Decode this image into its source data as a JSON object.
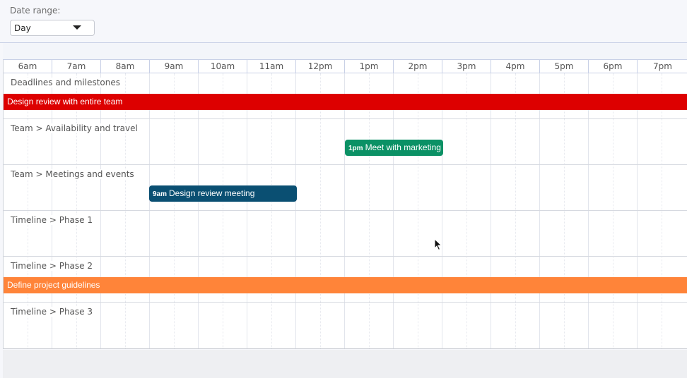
{
  "toolbar": {
    "date_range_label": "Date range:",
    "view_select": {
      "value": "Day"
    }
  },
  "timeline": {
    "hours": [
      "6am",
      "7am",
      "8am",
      "9am",
      "10am",
      "11am",
      "12pm",
      "1pm",
      "2pm",
      "3pm",
      "4pm",
      "5pm",
      "6pm",
      "7pm"
    ]
  },
  "lanes": [
    {
      "title": "Deadlines and milestones"
    },
    {
      "title": "Team > Availability and travel"
    },
    {
      "title": "Team > Meetings and events"
    },
    {
      "title": "Timeline > Phase 1"
    },
    {
      "title": "Timeline > Phase 2"
    },
    {
      "title": "Timeline > Phase 3"
    }
  ],
  "events": [
    {
      "title": "Design review with entire team",
      "time": "",
      "color": "#dd0000"
    },
    {
      "title": "Meet with marketing",
      "time": "1pm",
      "color": "#0b9165"
    },
    {
      "title": "Design review meeting",
      "time": "9am",
      "color": "#0a4f72"
    },
    {
      "title": "Define project guidelines",
      "time": "",
      "color": "#ff8439"
    }
  ],
  "colors": {
    "accent_border": "#c8d0e6"
  }
}
